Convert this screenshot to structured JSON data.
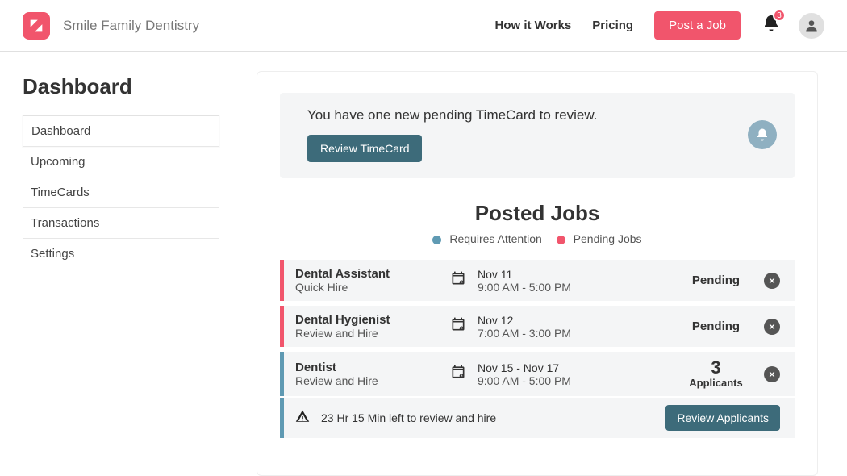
{
  "header": {
    "brand": "Smile Family Dentistry",
    "nav": {
      "how": "How it Works",
      "pricing": "Pricing"
    },
    "post_job": "Post a Job",
    "notif_count": "3"
  },
  "sidebar": {
    "title": "Dashboard",
    "items": [
      {
        "label": "Dashboard",
        "active": true
      },
      {
        "label": "Upcoming"
      },
      {
        "label": "TimeCards"
      },
      {
        "label": "Transactions"
      },
      {
        "label": "Settings"
      }
    ]
  },
  "banner": {
    "text": "You have one new pending TimeCard to review.",
    "button": "Review TimeCard"
  },
  "section": {
    "title": "Posted Jobs",
    "legend": {
      "attn": "Requires Attention",
      "pending": "Pending Jobs"
    }
  },
  "jobs": [
    {
      "title": "Dental Assistant",
      "sub": "Quick Hire",
      "date": "Nov 11",
      "hours": "9:00 AM - 5:00 PM",
      "status_type": "pending",
      "status_primary": "Pending",
      "accent": "pink"
    },
    {
      "title": "Dental Hygienist",
      "sub": "Review and Hire",
      "date": "Nov 12",
      "hours": "7:00 AM - 3:00 PM",
      "status_type": "pending",
      "status_primary": "Pending",
      "accent": "pink"
    },
    {
      "title": "Dentist",
      "sub": "Review and Hire",
      "date": "Nov 15 - Nov 17",
      "hours": "9:00 AM - 5:00 PM",
      "status_type": "applicants",
      "status_primary": "3",
      "status_secondary": "Applicants",
      "accent": "blue",
      "countdown": "23 Hr 15 Min left to review and hire",
      "footer_button": "Review Applicants"
    }
  ]
}
